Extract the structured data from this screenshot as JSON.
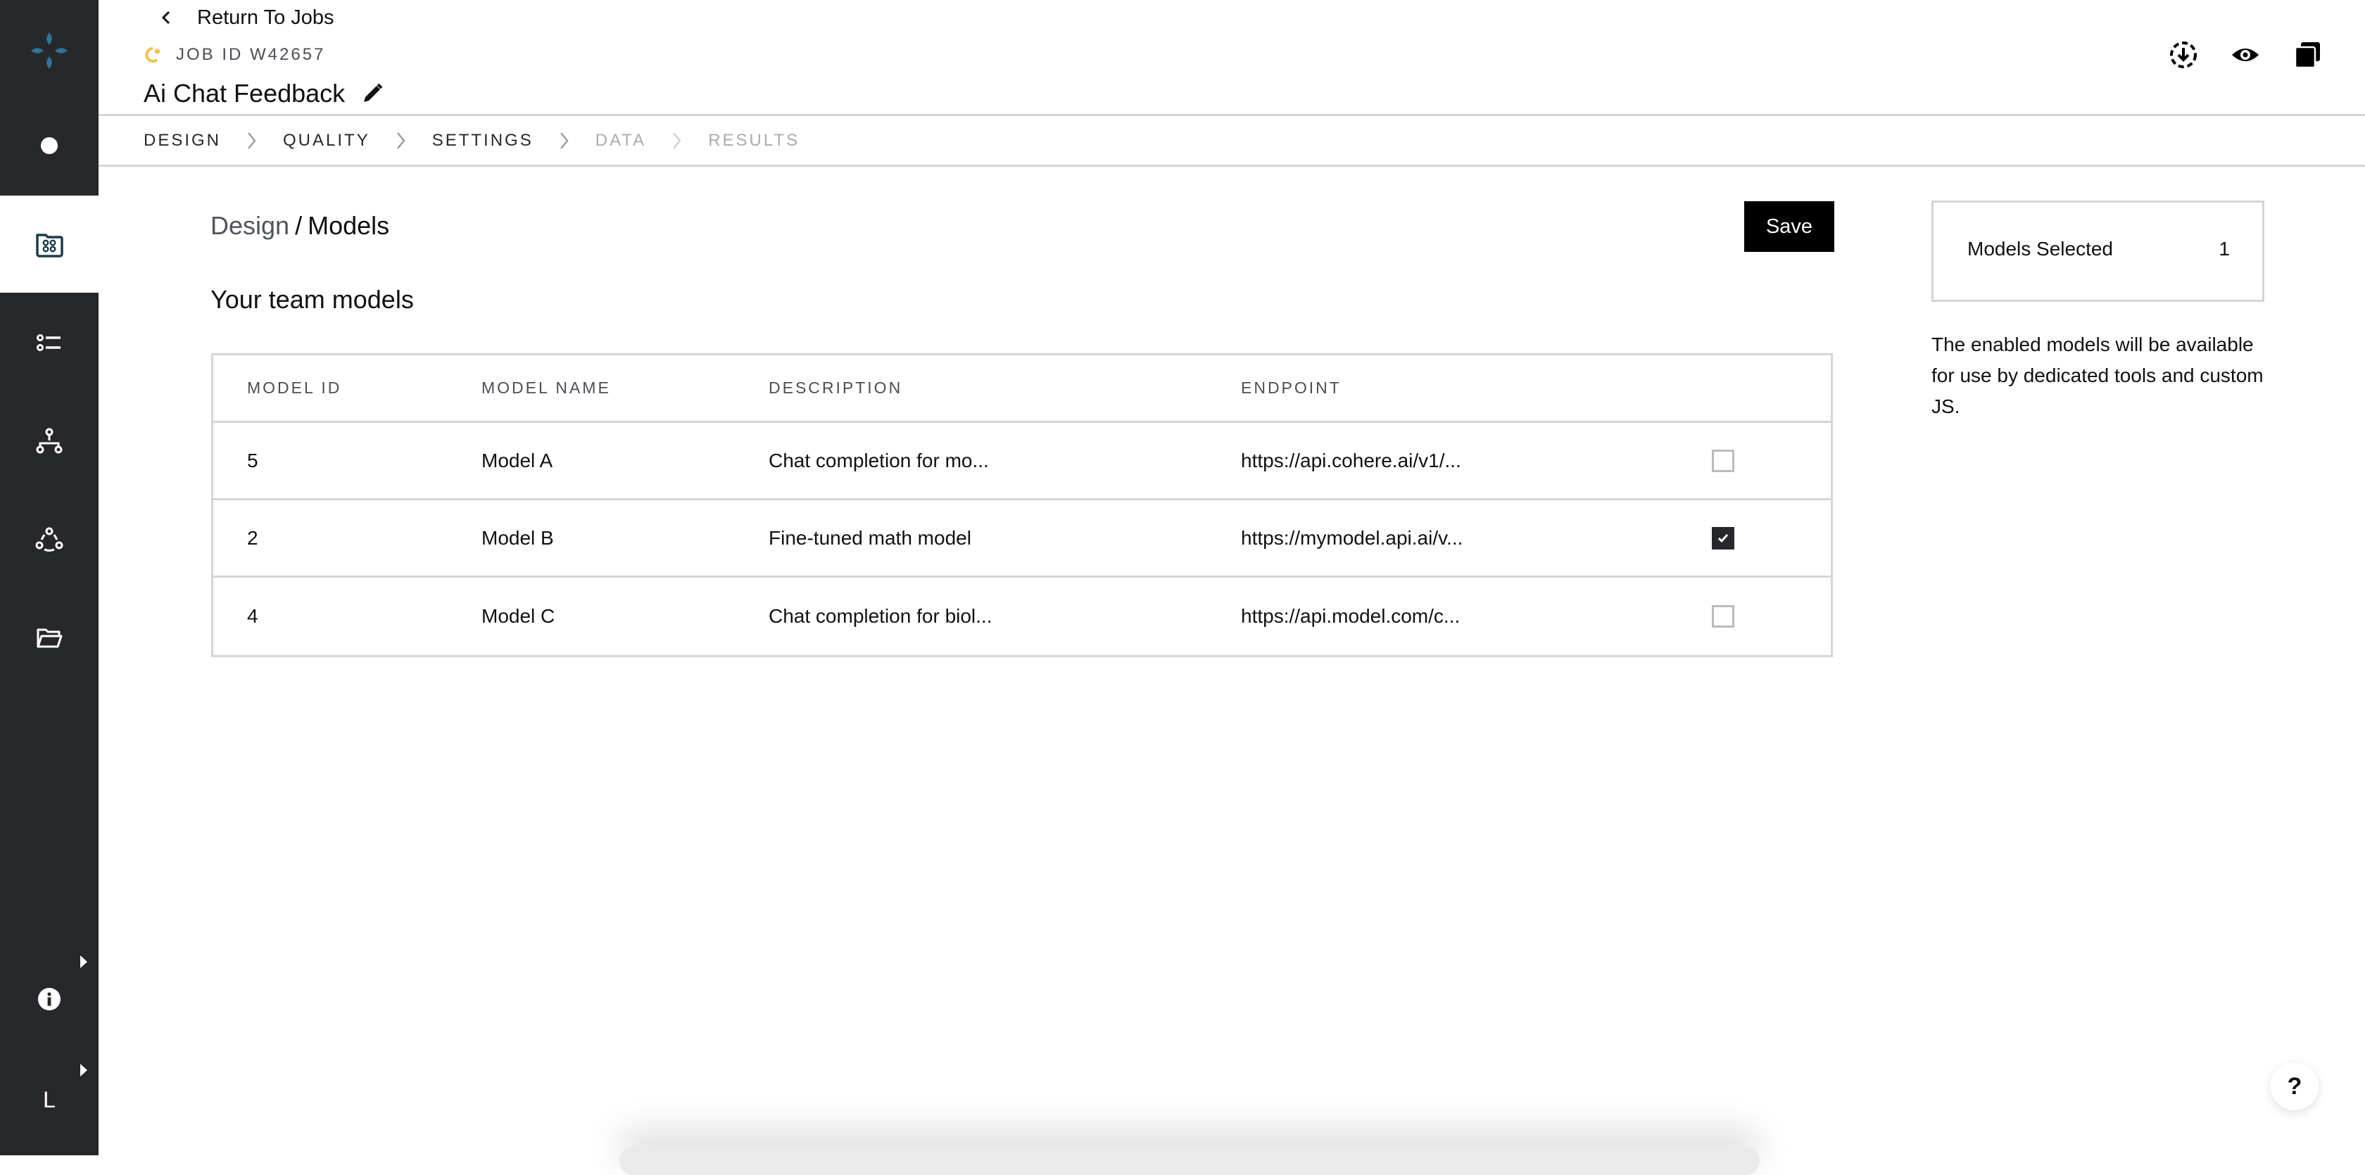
{
  "app": {
    "brand_color": "#2e7596",
    "sidebar_bg": "#27282b",
    "status_color": "#f0c24b"
  },
  "sidebar": {
    "items": [
      {
        "name": "home",
        "icon": "circle-dot-icon",
        "active": false
      },
      {
        "name": "jobs",
        "icon": "folder-grid-icon",
        "active": true
      },
      {
        "name": "list",
        "icon": "list-icon",
        "active": false
      },
      {
        "name": "workflows",
        "icon": "hierarchy-icon",
        "active": false
      },
      {
        "name": "team",
        "icon": "people-network-icon",
        "active": false
      },
      {
        "name": "files",
        "icon": "folder-open-icon",
        "active": false
      }
    ],
    "info_icon": "info-icon",
    "user_initial": "L"
  },
  "header": {
    "return_label": "Return To Jobs",
    "job_id": "JOB ID W42657",
    "job_title": "Ai Chat Feedback",
    "icons": [
      "download-progress-icon",
      "preview-eye-icon",
      "copy-icon"
    ]
  },
  "tabs": [
    {
      "label": "DESIGN",
      "enabled": true
    },
    {
      "label": "QUALITY",
      "enabled": true
    },
    {
      "label": "SETTINGS",
      "enabled": true
    },
    {
      "label": "DATA",
      "enabled": false
    },
    {
      "label": "RESULTS",
      "enabled": false
    }
  ],
  "main": {
    "breadcrumb": {
      "parent": "Design",
      "separator": "/",
      "current": "Models"
    },
    "section_title": "Your team models",
    "save_label": "Save",
    "table": {
      "columns": [
        "MODEL ID",
        "MODEL NAME",
        "DESCRIPTION",
        "ENDPOINT",
        ""
      ],
      "rows": [
        {
          "id": "5",
          "name": "Model A",
          "description": "Chat completion for mo...",
          "endpoint": "https://api.cohere.ai/v1/...",
          "selected": false
        },
        {
          "id": "2",
          "name": "Model B",
          "description": "Fine-tuned math model",
          "endpoint": "https://mymodel.api.ai/v...",
          "selected": true
        },
        {
          "id": "4",
          "name": "Model C",
          "description": "Chat completion for biol...",
          "endpoint": "https://api.model.com/c...",
          "selected": false
        }
      ]
    }
  },
  "side_panel": {
    "label": "Models Selected",
    "count": "1",
    "note": "The enabled models will be available for use by dedicated tools and custom JS."
  },
  "help": {
    "label": "?"
  }
}
